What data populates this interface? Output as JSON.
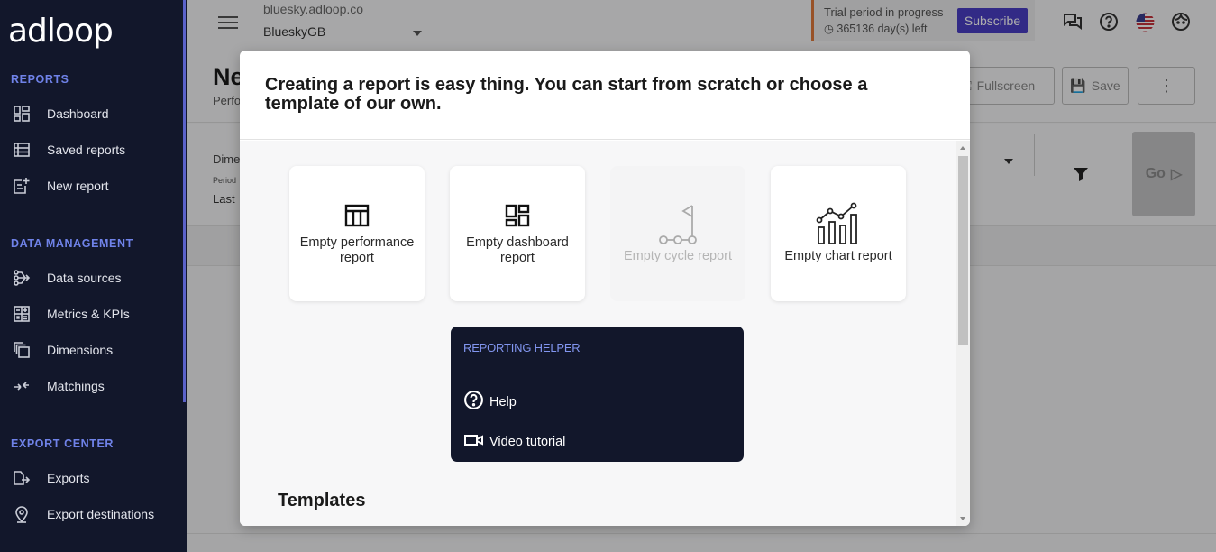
{
  "app": {
    "logo": "adloop"
  },
  "sidebar": {
    "sections": [
      {
        "title": "REPORTS",
        "items": [
          {
            "label": "Dashboard",
            "icon": "dashboard-icon"
          },
          {
            "label": "Saved reports",
            "icon": "list-icon"
          },
          {
            "label": "New report",
            "icon": "new-report-icon"
          }
        ]
      },
      {
        "title": "DATA MANAGEMENT",
        "items": [
          {
            "label": "Data sources",
            "icon": "data-sources-icon"
          },
          {
            "label": "Metrics & KPIs",
            "icon": "calculator-icon"
          },
          {
            "label": "Dimensions",
            "icon": "dimensions-icon"
          },
          {
            "label": "Matchings",
            "icon": "matching-icon"
          }
        ]
      },
      {
        "title": "EXPORT CENTER",
        "items": [
          {
            "label": "Exports",
            "icon": "export-icon"
          },
          {
            "label": "Export destinations",
            "icon": "location-pin-icon"
          }
        ]
      }
    ]
  },
  "topbar": {
    "domain": "bluesky.adloop.co",
    "account": "BlueskyGB",
    "trial_text": "Trial period in progress",
    "days_left": "365136 day(s) left",
    "subscribe_label": "Subscribe"
  },
  "page": {
    "title": "Ne",
    "subtitle": "Perfo",
    "fullscreen_label": "Fullscreen",
    "save_label": "Save",
    "dimension_label": "Dime",
    "period_label": "Period",
    "last_label": "Last",
    "go_label": "Go"
  },
  "modal": {
    "title": "Creating a report is easy thing. You can start from scratch or choose a template of our own.",
    "cards": [
      {
        "label": "Empty performance report",
        "icon": "table-icon",
        "disabled": false
      },
      {
        "label": "Empty dashboard report",
        "icon": "dashboard-icon",
        "disabled": false
      },
      {
        "label": "Empty cycle report",
        "icon": "cycle-flag-icon",
        "disabled": true
      },
      {
        "label": "Empty chart report",
        "icon": "chart-icon",
        "disabled": false
      }
    ],
    "helper": {
      "title": "REPORTING HELPER",
      "help_label": "Help",
      "video_label": "Video tutorial"
    },
    "templates_heading": "Templates"
  }
}
